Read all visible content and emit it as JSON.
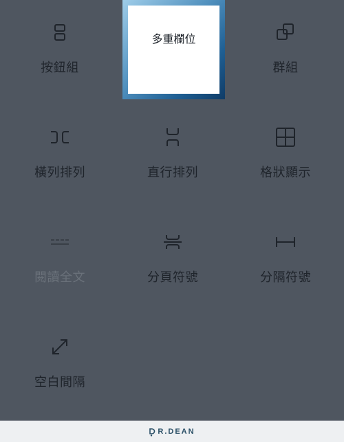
{
  "blocks": [
    {
      "id": "buttons",
      "label": "按鈕組",
      "icon": "buttons-icon",
      "selected": false,
      "disabled": false
    },
    {
      "id": "columns",
      "label": "多重欄位",
      "icon": "columns-icon",
      "selected": true,
      "disabled": false
    },
    {
      "id": "group",
      "label": "群組",
      "icon": "group-icon",
      "selected": false,
      "disabled": false
    },
    {
      "id": "row",
      "label": "橫列排列",
      "icon": "row-icon",
      "selected": false,
      "disabled": false
    },
    {
      "id": "stack",
      "label": "直行排列",
      "icon": "stack-icon",
      "selected": false,
      "disabled": false
    },
    {
      "id": "grid",
      "label": "格狀顯示",
      "icon": "grid-icon",
      "selected": false,
      "disabled": false
    },
    {
      "id": "more",
      "label": "閱讀全文",
      "icon": "more-icon",
      "selected": false,
      "disabled": true
    },
    {
      "id": "page-break",
      "label": "分頁符號",
      "icon": "page-break-icon",
      "selected": false,
      "disabled": false
    },
    {
      "id": "separator",
      "label": "分隔符號",
      "icon": "separator-icon",
      "selected": false,
      "disabled": false
    },
    {
      "id": "spacer",
      "label": "空白間隔",
      "icon": "spacer-icon",
      "selected": false,
      "disabled": false
    }
  ],
  "footer": {
    "brand_mark": "D",
    "brand_text": "R.DEAN"
  },
  "colors": {
    "overlay_background": "#4f5660",
    "icon_stroke": "#1f242b",
    "selected_border_start": "#9fcde9",
    "selected_border_end": "#0f3b66",
    "footer_background": "#eef0f2",
    "brand_color": "#2a4f66"
  }
}
